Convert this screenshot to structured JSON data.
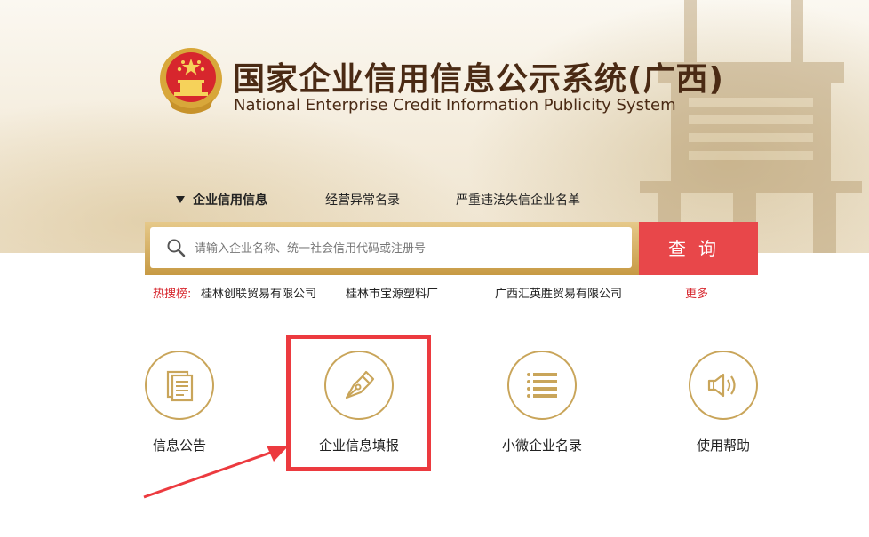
{
  "header": {
    "title_cn": "国家企业信用信息公示系统(广西)",
    "title_en": "National Enterprise Credit Information Publicity System"
  },
  "tabs": [
    {
      "label": "企业信用信息",
      "active": true
    },
    {
      "label": "经营异常名录",
      "active": false
    },
    {
      "label": "严重违法失信企业名单",
      "active": false
    }
  ],
  "search": {
    "placeholder": "请输入企业名称、统一社会信用代码或注册号",
    "button_label": "查询"
  },
  "hot_search": {
    "label": "热搜榜:",
    "items": [
      "桂林创联贸易有限公司",
      "桂林市宝源塑料厂",
      "广西汇英胜贸易有限公司"
    ],
    "more_label": "更多"
  },
  "quick_links": [
    {
      "label": "信息公告",
      "icon": "document-icon"
    },
    {
      "label": "企业信息填报",
      "icon": "pen-nib-icon"
    },
    {
      "label": "小微企业名录",
      "icon": "list-icon"
    },
    {
      "label": "使用帮助",
      "icon": "speaker-icon"
    }
  ],
  "colors": {
    "accent_gold": "#c9a55a",
    "search_button": "#e8474a",
    "highlight_red": "#ec3a3f",
    "title_brown": "#4a2a14"
  }
}
